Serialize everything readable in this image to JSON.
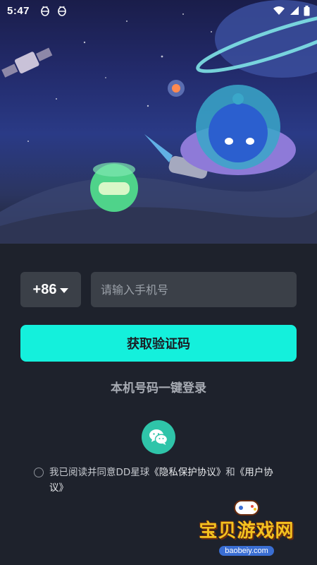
{
  "status_bar": {
    "time": "5:47",
    "notification_icons": [
      "bug-icon",
      "bug-icon"
    ],
    "right_icons": [
      "wifi-icon",
      "signal-icon",
      "battery-icon"
    ]
  },
  "hero": {
    "description_icons": [
      "planet-icon",
      "satellite-icon",
      "robot-icon",
      "astronaut-mascot-icon",
      "rocket-icon"
    ]
  },
  "login": {
    "country_code": "+86",
    "phone_placeholder": "请输入手机号",
    "phone_value": "",
    "get_code_label": "获取验证码",
    "one_key_login_label": "本机号码一键登录",
    "wechat_icon": "wechat-icon",
    "agreement": {
      "checked": false,
      "prefix": "我已阅读并同意DD星球",
      "privacy_link": "《隐私保护协议》",
      "and": "和",
      "user_link": "《用户协议》"
    }
  },
  "watermark": {
    "text": "宝贝游戏网",
    "url": "baobeiy.com"
  },
  "colors": {
    "background": "#1e222c",
    "accent": "#14f0dc",
    "input_bg": "#3b4048",
    "wechat": "#2fc4a9"
  }
}
